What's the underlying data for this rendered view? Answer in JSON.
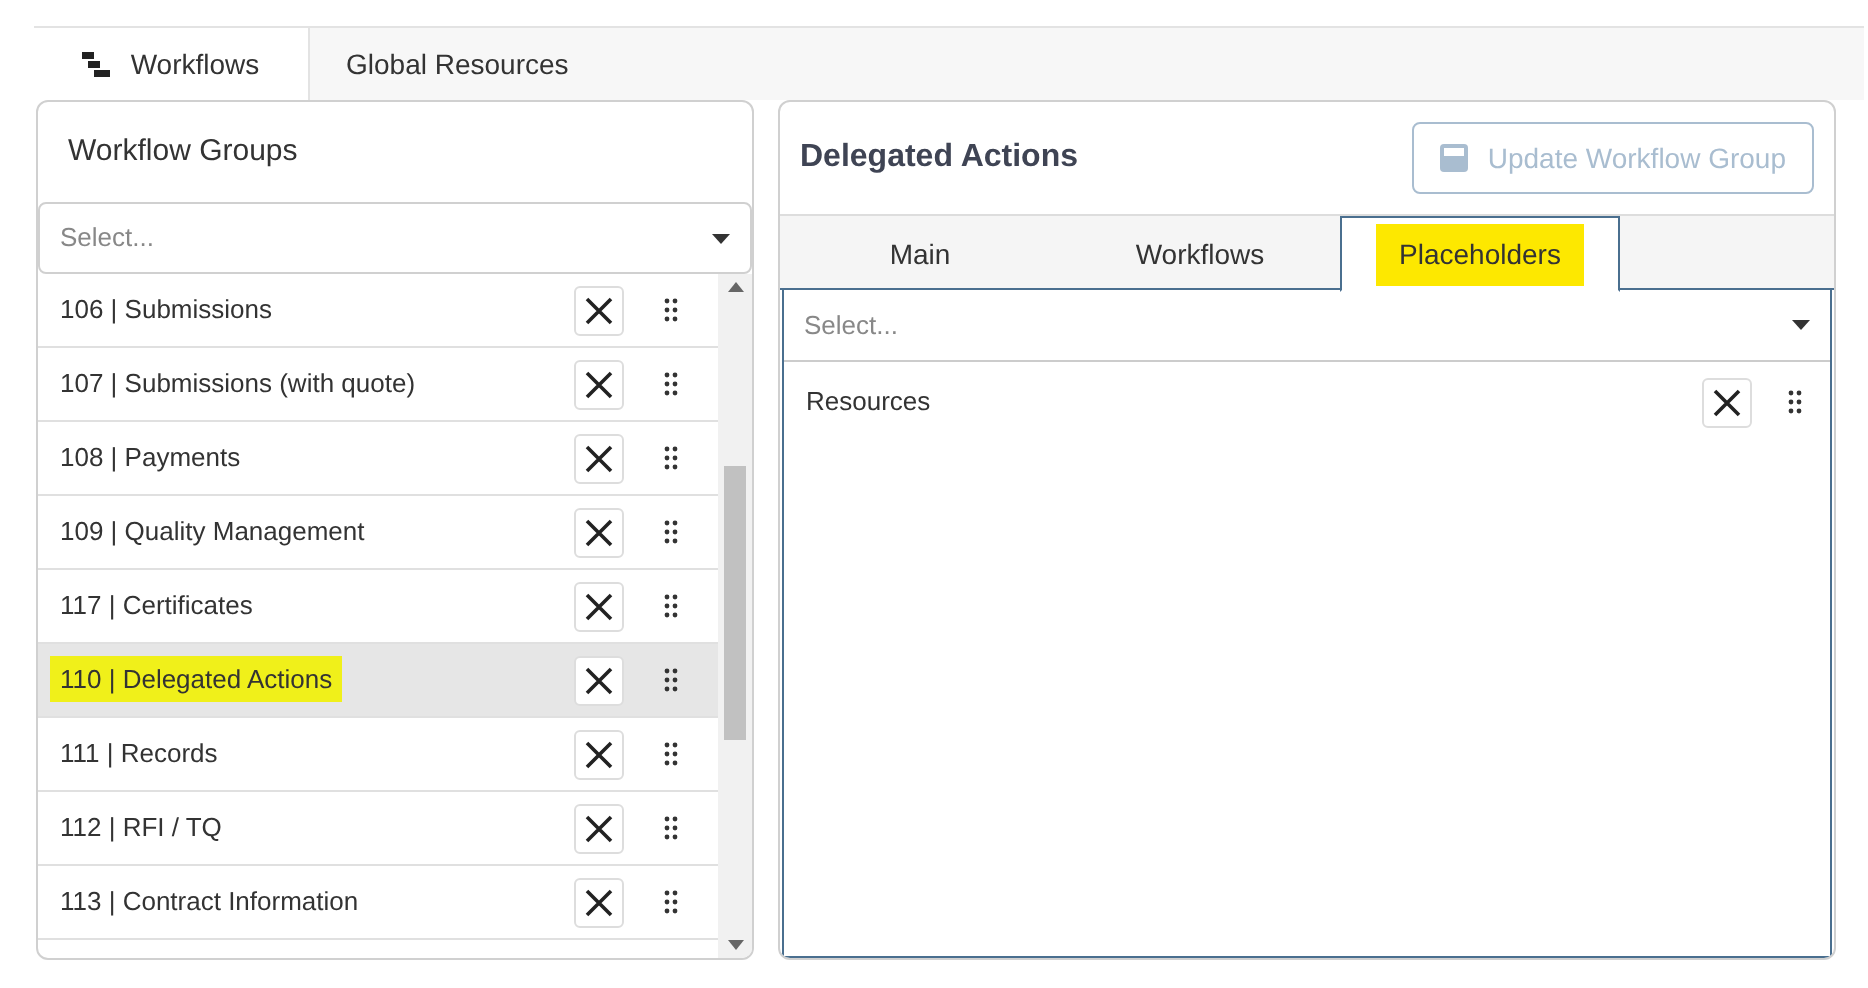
{
  "top_tabs": [
    {
      "label": "Workflows",
      "selected": true,
      "icon": true
    },
    {
      "label": "Global Resources",
      "selected": false,
      "icon": false
    }
  ],
  "groups_panel": {
    "title": "Workflow Groups",
    "select": {
      "placeholder": "Select..."
    },
    "items": [
      {
        "label": "106 | Submissions",
        "selected": false,
        "highlighted": false
      },
      {
        "label": "107 | Submissions (with quote)",
        "selected": false,
        "highlighted": false
      },
      {
        "label": "108 | Payments",
        "selected": false,
        "highlighted": false
      },
      {
        "label": "109 | Quality Management",
        "selected": false,
        "highlighted": false
      },
      {
        "label": "117 | Certificates",
        "selected": false,
        "highlighted": false
      },
      {
        "label": "110 | Delegated Actions",
        "selected": true,
        "highlighted": true
      },
      {
        "label": "111 | Records",
        "selected": false,
        "highlighted": false
      },
      {
        "label": "112 | RFI / TQ",
        "selected": false,
        "highlighted": false
      },
      {
        "label": "113 | Contract Information",
        "selected": false,
        "highlighted": false
      }
    ]
  },
  "detail_panel": {
    "title": "Delegated Actions",
    "update_button": {
      "label": "Update Workflow Group",
      "disabled": true
    },
    "tabs": [
      {
        "label": "Main",
        "selected": false,
        "highlighted": false
      },
      {
        "label": "Workflows",
        "selected": false,
        "highlighted": false
      },
      {
        "label": "Placeholders",
        "selected": true,
        "highlighted": true
      }
    ],
    "select": {
      "placeholder": "Select..."
    },
    "items": [
      {
        "label": "Resources"
      }
    ]
  }
}
